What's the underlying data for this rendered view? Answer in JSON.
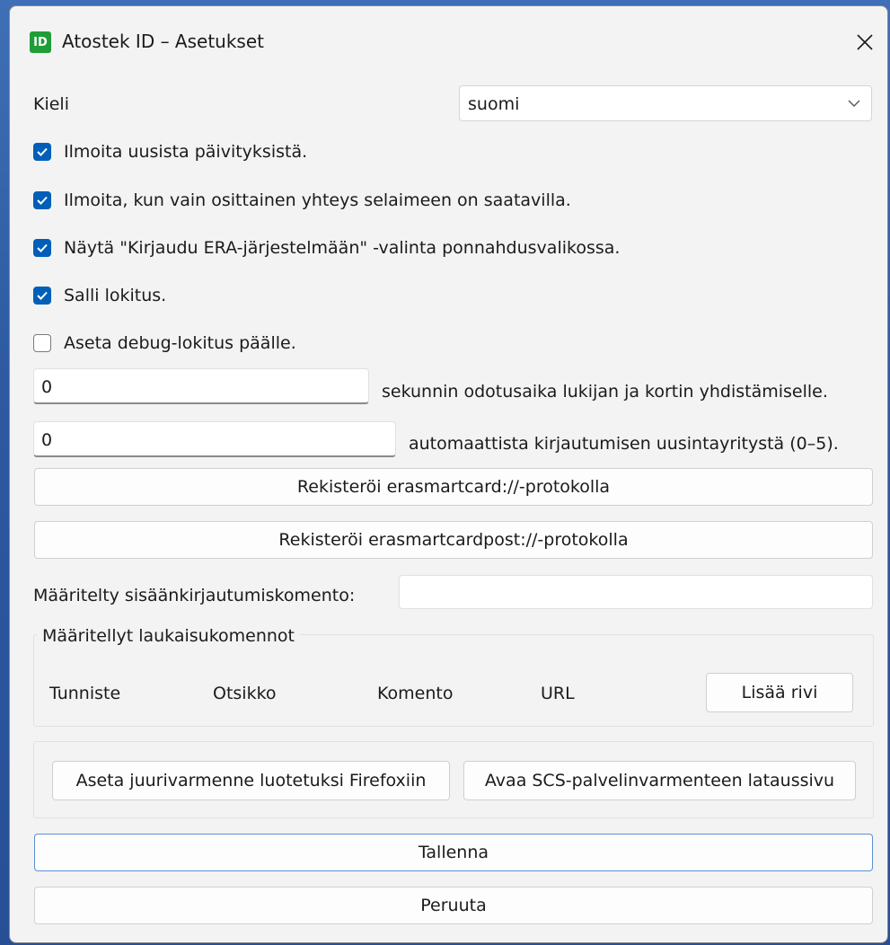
{
  "window": {
    "title": "Atostek ID – Asetukset",
    "icon_text": "ID",
    "icon_color": "#1f9d38"
  },
  "language": {
    "label": "Kieli",
    "selected": "suomi"
  },
  "checkboxes": [
    {
      "label": "Ilmoita uusista päivityksistä.",
      "checked": true
    },
    {
      "label": "Ilmoita, kun vain osittainen yhteys selaimeen on saatavilla.",
      "checked": true
    },
    {
      "label": "Näytä \"Kirjaudu ERA-järjestelmään\" -valinta ponnahdusvalikossa.",
      "checked": true
    },
    {
      "label": "Salli lokitus.",
      "checked": true
    },
    {
      "label": "Aseta debug-lokitus päälle.",
      "checked": false
    }
  ],
  "timeout": {
    "value": "0",
    "label": "sekunnin odotusaika lukijan ja kortin yhdistämiselle."
  },
  "retries": {
    "value": "0",
    "label": "automaattista kirjautumisen uusintayritystä (0–5)."
  },
  "buttons": {
    "register_erasmartcard": "Rekisteröi erasmartcard://-protokolla",
    "register_erasmartcardpost": "Rekisteröi erasmartcardpost://-protokolla",
    "trust_root_firefox": "Aseta juurivarmenne luotetuksi Firefoxiin",
    "open_scs_download": "Avaa SCS-palvelinvarmenteen lataussivu",
    "save": "Tallenna",
    "cancel": "Peruuta"
  },
  "login_command": {
    "label": "Määritelty sisäänkirjautumiskomento:",
    "value": ""
  },
  "launch_commands": {
    "title": "Määritellyt laukaisukomennot",
    "columns": [
      "Tunniste",
      "Otsikko",
      "Komento",
      "URL"
    ],
    "add_row": "Lisää rivi"
  },
  "colors": {
    "accent": "#005fb8",
    "window_bg": "#f3f3f3"
  }
}
